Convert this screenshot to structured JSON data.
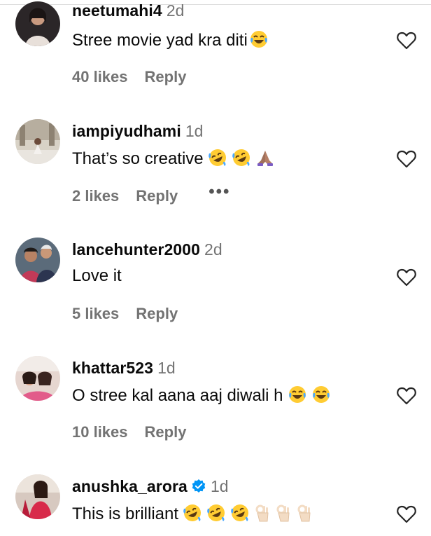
{
  "comments": [
    {
      "username": "neetumahi4",
      "time": "2d",
      "verified": false,
      "text": "Stree movie yad kra diti",
      "emojis": [
        "tears-of-joy"
      ],
      "likes": "40 likes",
      "reply": "Reply",
      "more": ""
    },
    {
      "username": "iampiyudhami",
      "time": "1d",
      "verified": false,
      "text": "That’s so creative",
      "emojis": [
        "rofl",
        "rofl",
        "folded-hands"
      ],
      "likes": "2 likes",
      "reply": "Reply",
      "more": "•••"
    },
    {
      "username": "lancehunter2000",
      "time": "2d",
      "verified": false,
      "text": "Love it",
      "emojis": [],
      "likes": "5 likes",
      "reply": "Reply",
      "more": ""
    },
    {
      "username": "khattar523",
      "time": "1d",
      "verified": false,
      "text": "O stree kal aana aaj diwali h",
      "emojis": [
        "tears-of-joy",
        "tears-of-joy"
      ],
      "likes": "10 likes",
      "reply": "Reply",
      "more": ""
    },
    {
      "username": "anushka_arora",
      "time": "1d",
      "verified": true,
      "text": "This is brilliant",
      "emojis": [
        "rofl",
        "rofl",
        "rofl",
        "ok-hand",
        "ok-hand",
        "ok-hand"
      ],
      "likes": "",
      "reply": "",
      "more": ""
    }
  ],
  "icons": {
    "like": "heart-outline-icon",
    "verified": "verified-badge-icon"
  },
  "colors": {
    "username": "#0a0a0a",
    "secondary": "#737373",
    "verified": "#0095f6"
  }
}
